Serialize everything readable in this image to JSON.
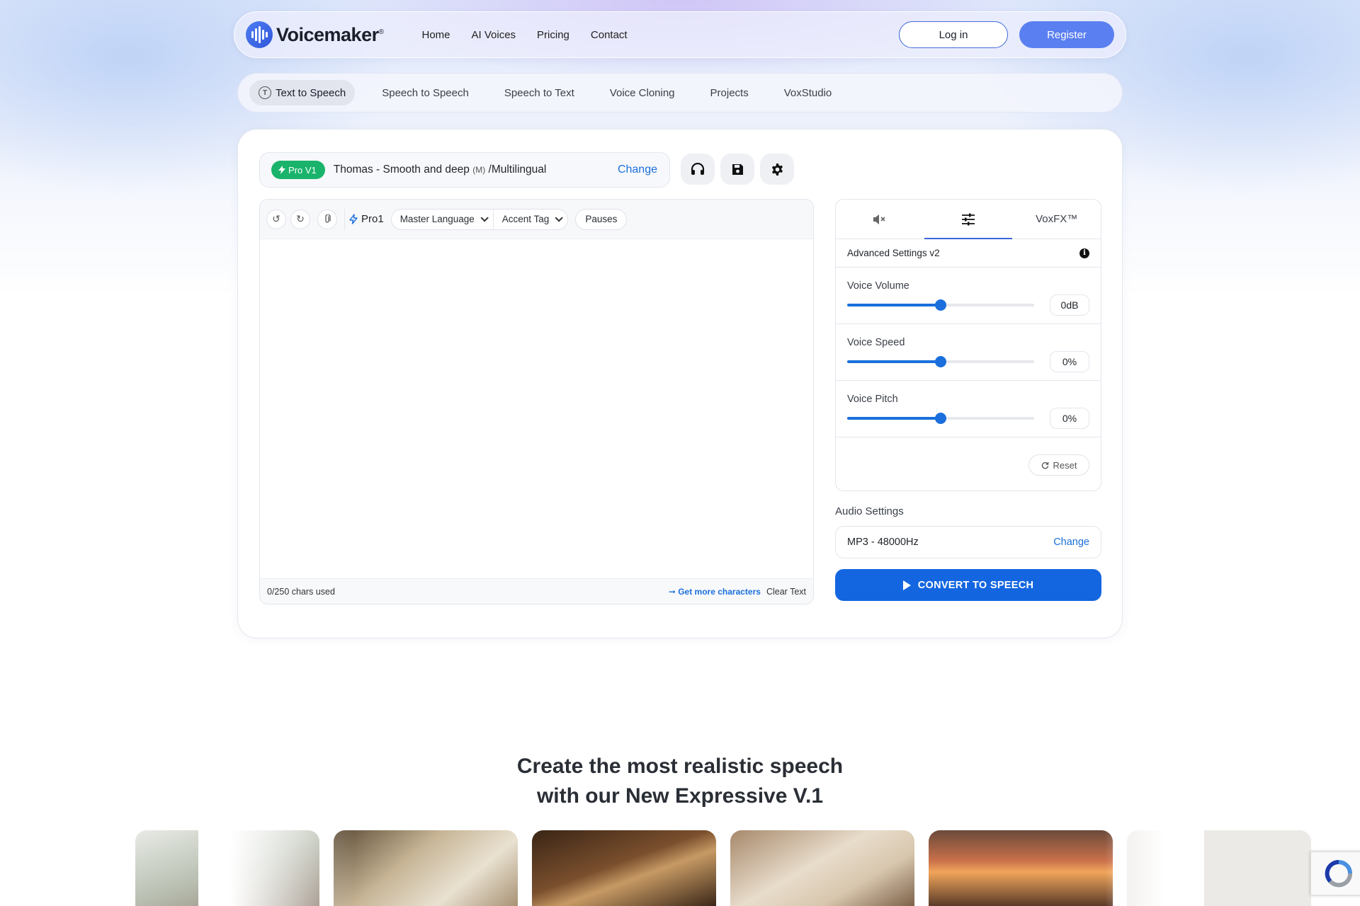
{
  "brand": {
    "name": "Voicemaker",
    "mark": "®"
  },
  "nav": {
    "links": [
      "Home",
      "AI Voices",
      "Pricing",
      "Contact"
    ],
    "login": "Log in",
    "register": "Register"
  },
  "subtabs": [
    "Text to Speech",
    "Speech to Speech",
    "Speech to Text",
    "Voice Cloning",
    "Projects",
    "VoxStudio"
  ],
  "subtab_icon_letter": "T",
  "voice": {
    "badge": "Pro V1",
    "name": "Thomas - Smooth and deep",
    "gender": "(M)",
    "lang": " /Multilingual",
    "change": "Change"
  },
  "editor": {
    "engine": "Pro1",
    "master_language": "Master Language",
    "accent_tag": "Accent Tag",
    "pauses": "Pauses",
    "chars_used": "0/250 chars used",
    "get_more": "➞ Get more characters",
    "clear": "Clear Text"
  },
  "panel": {
    "tab_voxfx": "VoxFX™",
    "advanced": "Advanced Settings v2",
    "sliders": [
      {
        "label": "Voice Volume",
        "value": "0dB",
        "position": 0.5
      },
      {
        "label": "Voice Speed",
        "value": "0%",
        "position": 0.5
      },
      {
        "label": "Voice Pitch",
        "value": "0%",
        "position": 0.5
      }
    ],
    "reset": "Reset"
  },
  "audio": {
    "label": "Audio Settings",
    "value": "MP3 - 48000Hz",
    "change": "Change"
  },
  "convert": "CONVERT TO SPEECH",
  "headline": {
    "line1": "Create the most realistic speech",
    "line2": "with our New Expressive V.1"
  },
  "colors": {
    "primary": "#1466e0",
    "link": "#1a6fdc",
    "pro_badge": "#19b36b",
    "register": "#5a7ff0"
  }
}
